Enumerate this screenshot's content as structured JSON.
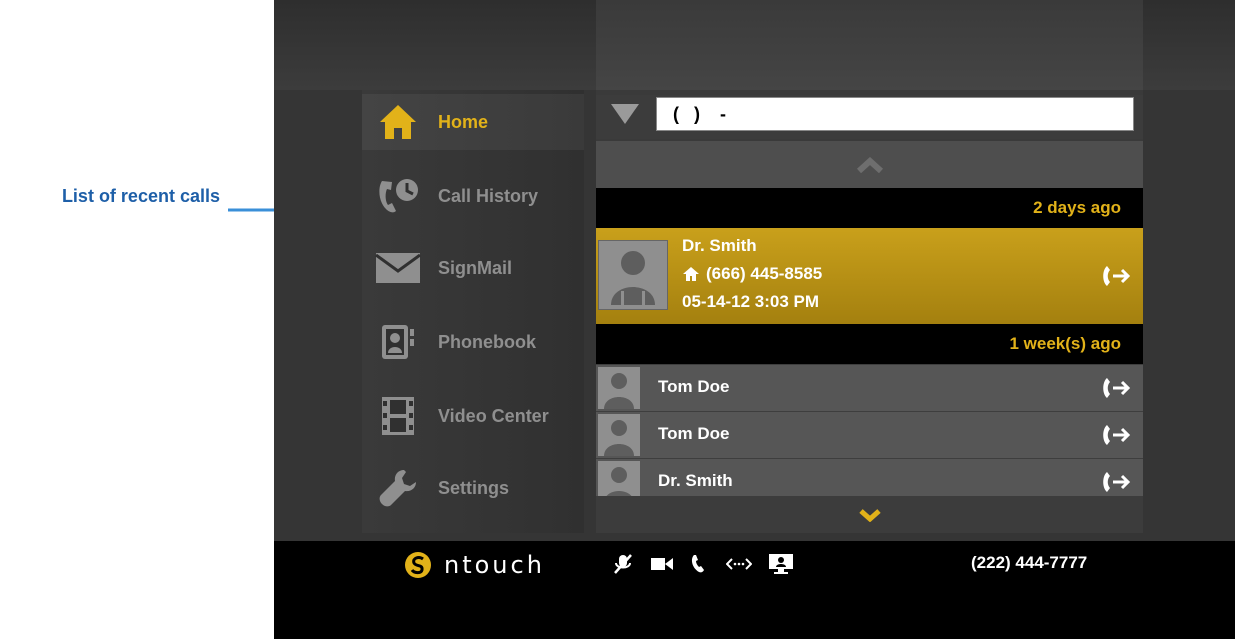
{
  "callout": {
    "text": "List of recent calls"
  },
  "sidebar": {
    "items": [
      {
        "label": "Home",
        "icon": "home-icon",
        "active": true
      },
      {
        "label": "Call History",
        "icon": "call-history-icon"
      },
      {
        "label": "SignMail",
        "icon": "envelope-icon"
      },
      {
        "label": "Phonebook",
        "icon": "phonebook-icon"
      },
      {
        "label": "Video Center",
        "icon": "film-icon"
      },
      {
        "label": "Settings",
        "icon": "wrench-icon"
      }
    ]
  },
  "dial": {
    "value": "(   )    -"
  },
  "calls": {
    "groups": [
      {
        "label": "2 days ago"
      },
      {
        "label": "1 week(s) ago"
      }
    ],
    "selected": {
      "name": "Dr. Smith",
      "phone": "(666) 445-8585",
      "datetime": "05-14-12  3:03 PM"
    },
    "rows": [
      {
        "name": "Tom Doe"
      },
      {
        "name": "Tom Doe"
      },
      {
        "name": "Dr. Smith"
      }
    ]
  },
  "status_bar": {
    "brand": "ntouch",
    "phone": "(222) 444-7777"
  },
  "colors": {
    "accent": "#e2b219",
    "callout": "#1e5fa8",
    "selected_row": "#b8921a"
  }
}
